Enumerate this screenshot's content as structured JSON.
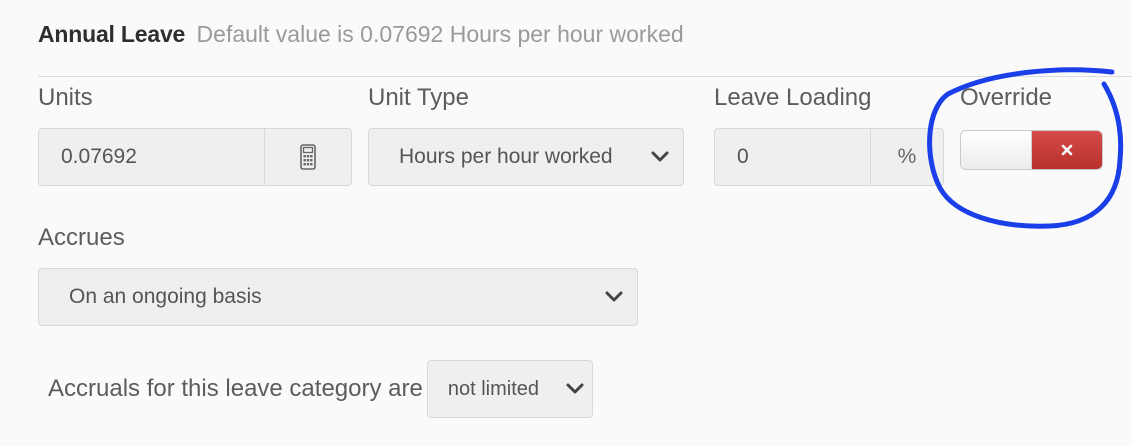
{
  "header": {
    "title": "Annual Leave",
    "subtitle": "Default value is 0.07692 Hours per hour worked"
  },
  "units": {
    "label": "Units",
    "value": "0.07692",
    "addon_icon": "calculator-icon"
  },
  "unit_type": {
    "label": "Unit Type",
    "selected": "Hours per hour worked"
  },
  "leave_loading": {
    "label": "Leave Loading",
    "value": "0",
    "suffix": "%"
  },
  "override": {
    "label": "Override",
    "state": "off",
    "off_icon": "close-icon",
    "off_color": "#c9403c"
  },
  "accrues": {
    "label": "Accrues",
    "selected": "On an ongoing basis"
  },
  "accruals": {
    "sentence": "Accruals for this leave category are",
    "selected": "not limited"
  },
  "annotation": {
    "shape": "hand-drawn circle",
    "color": "#1a3ee8"
  }
}
